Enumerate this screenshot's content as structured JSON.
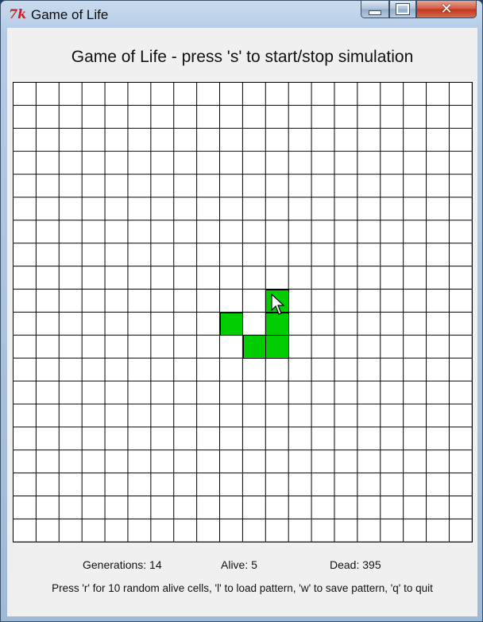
{
  "window": {
    "title": "Game of Life",
    "icon_name": "tk-feather-icon",
    "controls": {
      "minimize": "minimize-icon",
      "maximize": "maximize-icon",
      "close": "close-icon",
      "close_glyph": "✕"
    }
  },
  "main": {
    "heading": "Game of Life - press 's'  to start/stop simulation",
    "grid": {
      "rows": 20,
      "cols": 20,
      "alive_color": "#00cc00",
      "dead_color": "#ffffff",
      "line_color": "#000000",
      "alive_cells": [
        [
          9,
          11
        ],
        [
          10,
          9
        ],
        [
          10,
          11
        ],
        [
          11,
          10
        ],
        [
          11,
          11
        ]
      ]
    },
    "stats": {
      "generations": "Generations: 14",
      "alive": "Alive: 5",
      "dead": "Dead: 395"
    },
    "help": "Press 'r' for 10 random alive cells, 'l' to load pattern, 'w' to save pattern, 'q' to quit"
  }
}
